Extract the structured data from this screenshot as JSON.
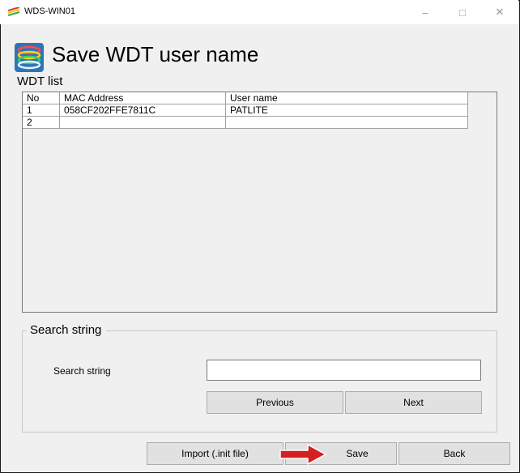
{
  "window": {
    "title": "WDS-WIN01",
    "minimize_glyph": "–",
    "maximize_glyph": "□",
    "close_glyph": "✕"
  },
  "header": {
    "title": "Save WDT user name",
    "icon": "wdt-signal-icon"
  },
  "wdt_list": {
    "label": "WDT list",
    "columns": [
      "No",
      "MAC Address",
      "User name"
    ],
    "rows": [
      [
        "1",
        "058CF202FFE7811C",
        "PATLITE"
      ],
      [
        "2",
        "",
        ""
      ]
    ]
  },
  "search": {
    "group_title": "Search string",
    "field_label": "Search string",
    "value": "",
    "previous_label": "Previous",
    "next_label": "Next"
  },
  "footer": {
    "import_label": "Import (.init file)",
    "save_label": "Save",
    "back_label": "Back"
  },
  "colors": {
    "annotation_arrow": "#d42020"
  }
}
